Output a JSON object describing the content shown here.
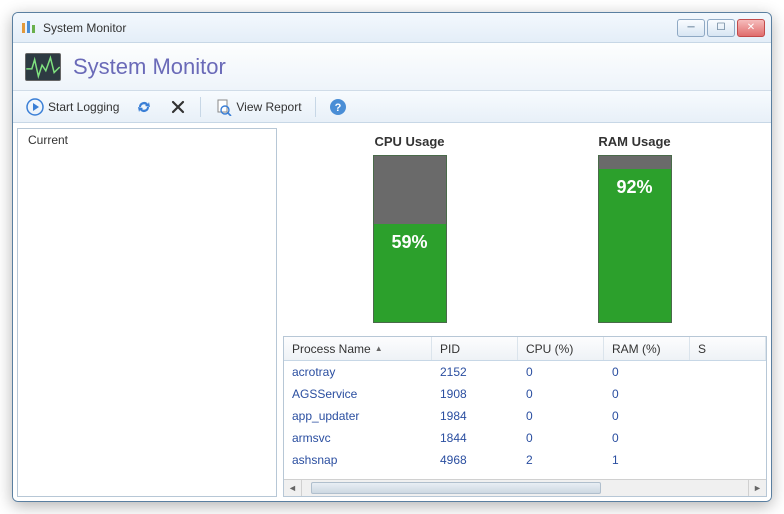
{
  "window": {
    "title": "System Monitor"
  },
  "header": {
    "app_title": "System Monitor"
  },
  "toolbar": {
    "start_logging": "Start Logging",
    "view_report": "View Report"
  },
  "sidebar": {
    "items": [
      {
        "label": "Current"
      }
    ]
  },
  "gauges": {
    "cpu": {
      "label": "CPU Usage",
      "value_text": "59%"
    },
    "ram": {
      "label": "RAM Usage",
      "value_text": "92%"
    }
  },
  "table": {
    "columns": {
      "name": "Process Name",
      "pid": "PID",
      "cpu": "CPU (%)",
      "ram": "RAM (%)",
      "last": "S"
    },
    "rows": [
      {
        "name": "acrotray",
        "pid": "2152",
        "cpu": "0",
        "ram": "0"
      },
      {
        "name": "AGSService",
        "pid": "1908",
        "cpu": "0",
        "ram": "0"
      },
      {
        "name": "app_updater",
        "pid": "1984",
        "cpu": "0",
        "ram": "0"
      },
      {
        "name": "armsvc",
        "pid": "1844",
        "cpu": "0",
        "ram": "0"
      },
      {
        "name": "ashsnap",
        "pid": "4968",
        "cpu": "2",
        "ram": "1"
      }
    ]
  },
  "chart_data": [
    {
      "type": "bar",
      "title": "CPU Usage",
      "categories": [
        "CPU"
      ],
      "values": [
        59
      ],
      "ylabel": "%",
      "ylim": [
        0,
        100
      ]
    },
    {
      "type": "bar",
      "title": "RAM Usage",
      "categories": [
        "RAM"
      ],
      "values": [
        92
      ],
      "ylabel": "%",
      "ylim": [
        0,
        100
      ]
    }
  ]
}
